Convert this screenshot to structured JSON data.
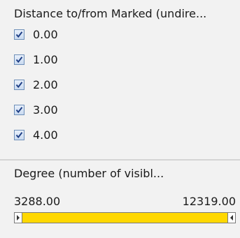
{
  "distance_filter": {
    "title": "Distance to/from Marked (undire...",
    "options": [
      {
        "label": "0.00",
        "checked": true
      },
      {
        "label": "1.00",
        "checked": true
      },
      {
        "label": "2.00",
        "checked": true
      },
      {
        "label": "3.00",
        "checked": true
      },
      {
        "label": "4.00",
        "checked": true
      }
    ]
  },
  "degree_filter": {
    "title": "Degree (number of visibl...",
    "min_label": "3288.00",
    "max_label": "12319.00",
    "selected_fraction": [
      0.0,
      1.0
    ],
    "fill_color": "#ffd800"
  },
  "colors": {
    "panel_bg": "#f2f2f2",
    "checkbox_border": "#6e8fb8",
    "checkmark": "#1f3f86"
  }
}
